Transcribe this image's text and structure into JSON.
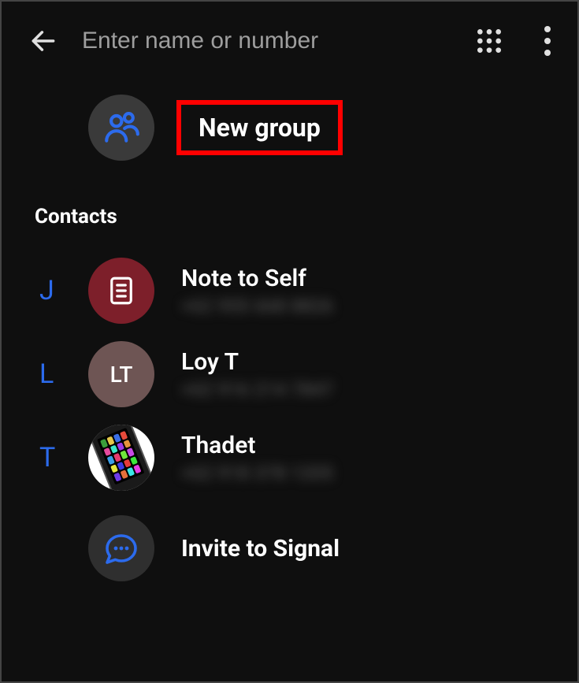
{
  "header": {
    "search_placeholder": "Enter name or number"
  },
  "new_group": {
    "label": "New group"
  },
  "contacts_section": {
    "title": "Contacts"
  },
  "contacts": [
    {
      "letter": "J",
      "name": "Note to Self",
      "number": "+62 955 668 8826",
      "avatar_type": "note"
    },
    {
      "letter": "L",
      "name": "Loy T",
      "number": "+62 916 214 7847",
      "avatar_initials": "LT",
      "avatar_type": "initials"
    },
    {
      "letter": "T",
      "name": "Thadet",
      "number": "+62 918 378 1205",
      "avatar_type": "phone"
    }
  ],
  "invite": {
    "label": "Invite to Signal"
  }
}
